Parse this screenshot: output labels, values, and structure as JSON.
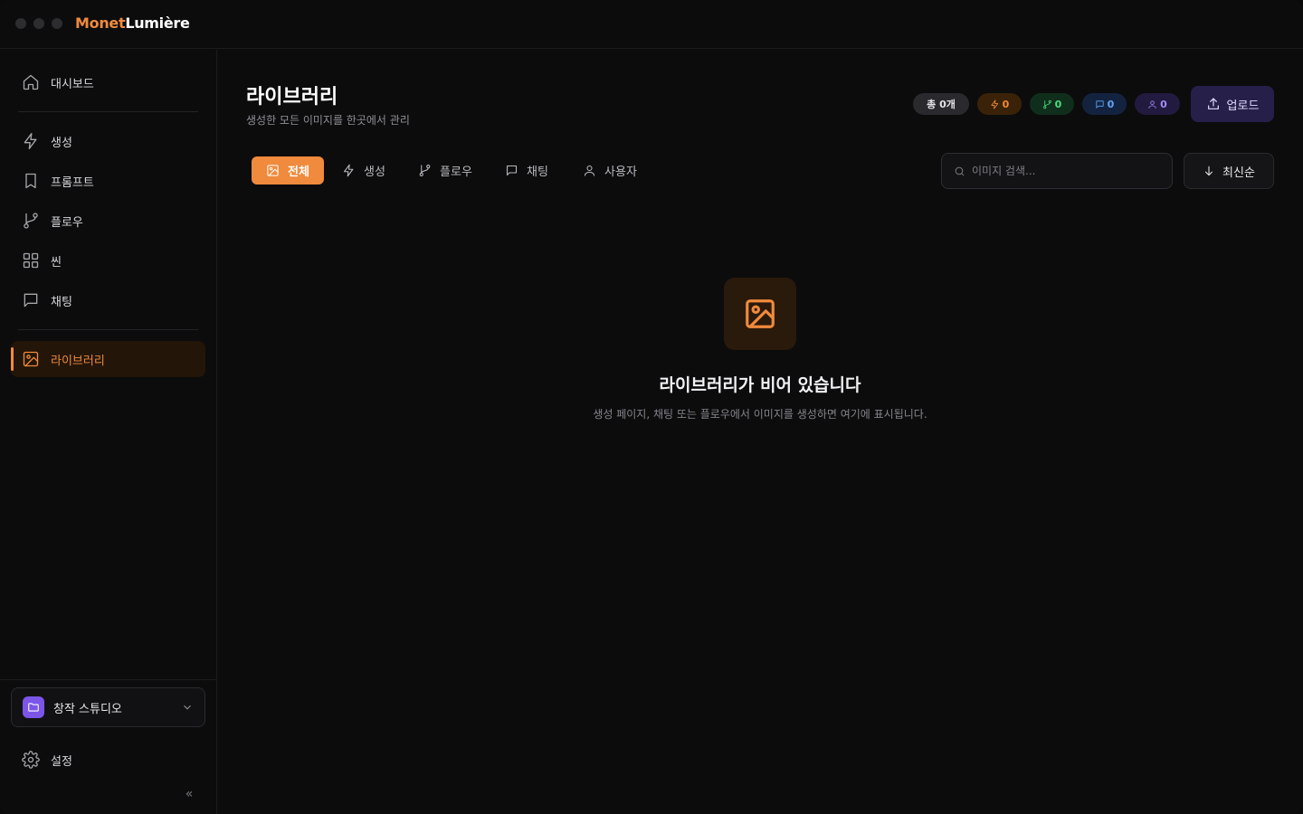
{
  "app": {
    "title_part1": "Monet",
    "title_part2": "Lumière"
  },
  "sidebar": {
    "items": [
      {
        "label": "대시보드",
        "icon": "home-icon"
      },
      {
        "label": "생성",
        "icon": "bolt-icon"
      },
      {
        "label": "프롬프트",
        "icon": "bookmark-icon"
      },
      {
        "label": "플로우",
        "icon": "git-branch-icon"
      },
      {
        "label": "씬",
        "icon": "grid-icon"
      },
      {
        "label": "채팅",
        "icon": "chat-icon"
      },
      {
        "label": "라이브러리",
        "icon": "image-icon",
        "active": true
      }
    ],
    "workspace": {
      "label": "창작 스튜디오",
      "icon": "folder-icon"
    },
    "settings_label": "설정",
    "collapse_glyph": "«"
  },
  "header": {
    "title": "라이브러리",
    "subtitle": "생성한 모든 이미지를 한곳에서 관리",
    "stats": {
      "total": "총 0개",
      "generate": "0",
      "flow": "0",
      "chat": "0",
      "user": "0"
    },
    "upload_label": "업로드"
  },
  "tabs": [
    {
      "label": "전체",
      "icon": "image-icon",
      "active": true
    },
    {
      "label": "생성",
      "icon": "bolt-icon"
    },
    {
      "label": "플로우",
      "icon": "git-branch-icon"
    },
    {
      "label": "채팅",
      "icon": "chat-icon"
    },
    {
      "label": "사용자",
      "icon": "user-icon"
    }
  ],
  "search": {
    "placeholder": "이미지 검색..."
  },
  "sort": {
    "label": "최신순"
  },
  "empty_state": {
    "title": "라이브러리가 비어 있습니다",
    "description": "생성 페이지, 채팅 또는 플로우에서 이미지를 생성하면 여기에 표시됩니다."
  },
  "colors": {
    "accent": "#f08a3c",
    "upload_bg": "#261f4a",
    "workspace_icon": "#7b55e8",
    "stat_generate": "#f08a3c",
    "stat_flow": "#4ade80",
    "stat_chat": "#60a5fa",
    "stat_user": "#a78bfa"
  }
}
